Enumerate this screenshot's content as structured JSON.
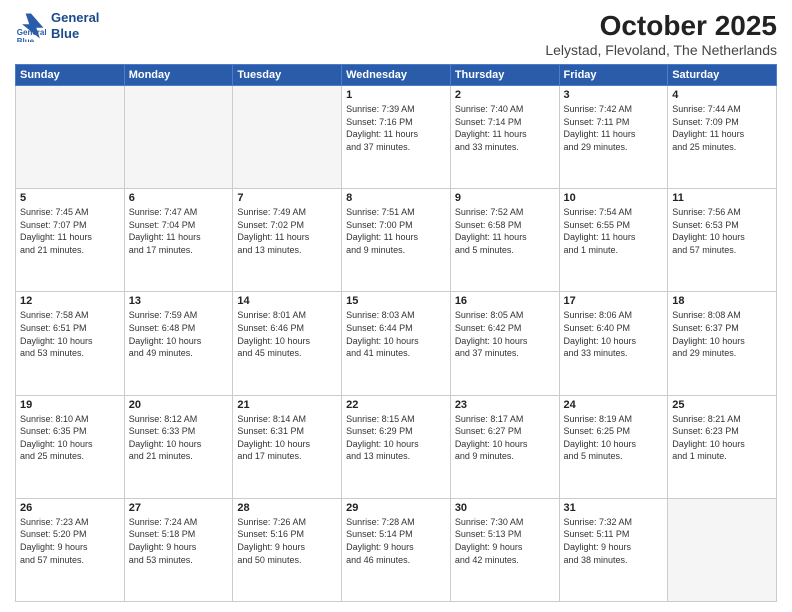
{
  "header": {
    "logo_line1": "General",
    "logo_line2": "Blue",
    "title": "October 2025",
    "subtitle": "Lelystad, Flevoland, The Netherlands"
  },
  "weekdays": [
    "Sunday",
    "Monday",
    "Tuesday",
    "Wednesday",
    "Thursday",
    "Friday",
    "Saturday"
  ],
  "weeks": [
    [
      {
        "day": "",
        "info": ""
      },
      {
        "day": "",
        "info": ""
      },
      {
        "day": "",
        "info": ""
      },
      {
        "day": "1",
        "info": "Sunrise: 7:39 AM\nSunset: 7:16 PM\nDaylight: 11 hours\nand 37 minutes."
      },
      {
        "day": "2",
        "info": "Sunrise: 7:40 AM\nSunset: 7:14 PM\nDaylight: 11 hours\nand 33 minutes."
      },
      {
        "day": "3",
        "info": "Sunrise: 7:42 AM\nSunset: 7:11 PM\nDaylight: 11 hours\nand 29 minutes."
      },
      {
        "day": "4",
        "info": "Sunrise: 7:44 AM\nSunset: 7:09 PM\nDaylight: 11 hours\nand 25 minutes."
      }
    ],
    [
      {
        "day": "5",
        "info": "Sunrise: 7:45 AM\nSunset: 7:07 PM\nDaylight: 11 hours\nand 21 minutes."
      },
      {
        "day": "6",
        "info": "Sunrise: 7:47 AM\nSunset: 7:04 PM\nDaylight: 11 hours\nand 17 minutes."
      },
      {
        "day": "7",
        "info": "Sunrise: 7:49 AM\nSunset: 7:02 PM\nDaylight: 11 hours\nand 13 minutes."
      },
      {
        "day": "8",
        "info": "Sunrise: 7:51 AM\nSunset: 7:00 PM\nDaylight: 11 hours\nand 9 minutes."
      },
      {
        "day": "9",
        "info": "Sunrise: 7:52 AM\nSunset: 6:58 PM\nDaylight: 11 hours\nand 5 minutes."
      },
      {
        "day": "10",
        "info": "Sunrise: 7:54 AM\nSunset: 6:55 PM\nDaylight: 11 hours\nand 1 minute."
      },
      {
        "day": "11",
        "info": "Sunrise: 7:56 AM\nSunset: 6:53 PM\nDaylight: 10 hours\nand 57 minutes."
      }
    ],
    [
      {
        "day": "12",
        "info": "Sunrise: 7:58 AM\nSunset: 6:51 PM\nDaylight: 10 hours\nand 53 minutes."
      },
      {
        "day": "13",
        "info": "Sunrise: 7:59 AM\nSunset: 6:48 PM\nDaylight: 10 hours\nand 49 minutes."
      },
      {
        "day": "14",
        "info": "Sunrise: 8:01 AM\nSunset: 6:46 PM\nDaylight: 10 hours\nand 45 minutes."
      },
      {
        "day": "15",
        "info": "Sunrise: 8:03 AM\nSunset: 6:44 PM\nDaylight: 10 hours\nand 41 minutes."
      },
      {
        "day": "16",
        "info": "Sunrise: 8:05 AM\nSunset: 6:42 PM\nDaylight: 10 hours\nand 37 minutes."
      },
      {
        "day": "17",
        "info": "Sunrise: 8:06 AM\nSunset: 6:40 PM\nDaylight: 10 hours\nand 33 minutes."
      },
      {
        "day": "18",
        "info": "Sunrise: 8:08 AM\nSunset: 6:37 PM\nDaylight: 10 hours\nand 29 minutes."
      }
    ],
    [
      {
        "day": "19",
        "info": "Sunrise: 8:10 AM\nSunset: 6:35 PM\nDaylight: 10 hours\nand 25 minutes."
      },
      {
        "day": "20",
        "info": "Sunrise: 8:12 AM\nSunset: 6:33 PM\nDaylight: 10 hours\nand 21 minutes."
      },
      {
        "day": "21",
        "info": "Sunrise: 8:14 AM\nSunset: 6:31 PM\nDaylight: 10 hours\nand 17 minutes."
      },
      {
        "day": "22",
        "info": "Sunrise: 8:15 AM\nSunset: 6:29 PM\nDaylight: 10 hours\nand 13 minutes."
      },
      {
        "day": "23",
        "info": "Sunrise: 8:17 AM\nSunset: 6:27 PM\nDaylight: 10 hours\nand 9 minutes."
      },
      {
        "day": "24",
        "info": "Sunrise: 8:19 AM\nSunset: 6:25 PM\nDaylight: 10 hours\nand 5 minutes."
      },
      {
        "day": "25",
        "info": "Sunrise: 8:21 AM\nSunset: 6:23 PM\nDaylight: 10 hours\nand 1 minute."
      }
    ],
    [
      {
        "day": "26",
        "info": "Sunrise: 7:23 AM\nSunset: 5:20 PM\nDaylight: 9 hours\nand 57 minutes."
      },
      {
        "day": "27",
        "info": "Sunrise: 7:24 AM\nSunset: 5:18 PM\nDaylight: 9 hours\nand 53 minutes."
      },
      {
        "day": "28",
        "info": "Sunrise: 7:26 AM\nSunset: 5:16 PM\nDaylight: 9 hours\nand 50 minutes."
      },
      {
        "day": "29",
        "info": "Sunrise: 7:28 AM\nSunset: 5:14 PM\nDaylight: 9 hours\nand 46 minutes."
      },
      {
        "day": "30",
        "info": "Sunrise: 7:30 AM\nSunset: 5:13 PM\nDaylight: 9 hours\nand 42 minutes."
      },
      {
        "day": "31",
        "info": "Sunrise: 7:32 AM\nSunset: 5:11 PM\nDaylight: 9 hours\nand 38 minutes."
      },
      {
        "day": "",
        "info": ""
      }
    ]
  ]
}
